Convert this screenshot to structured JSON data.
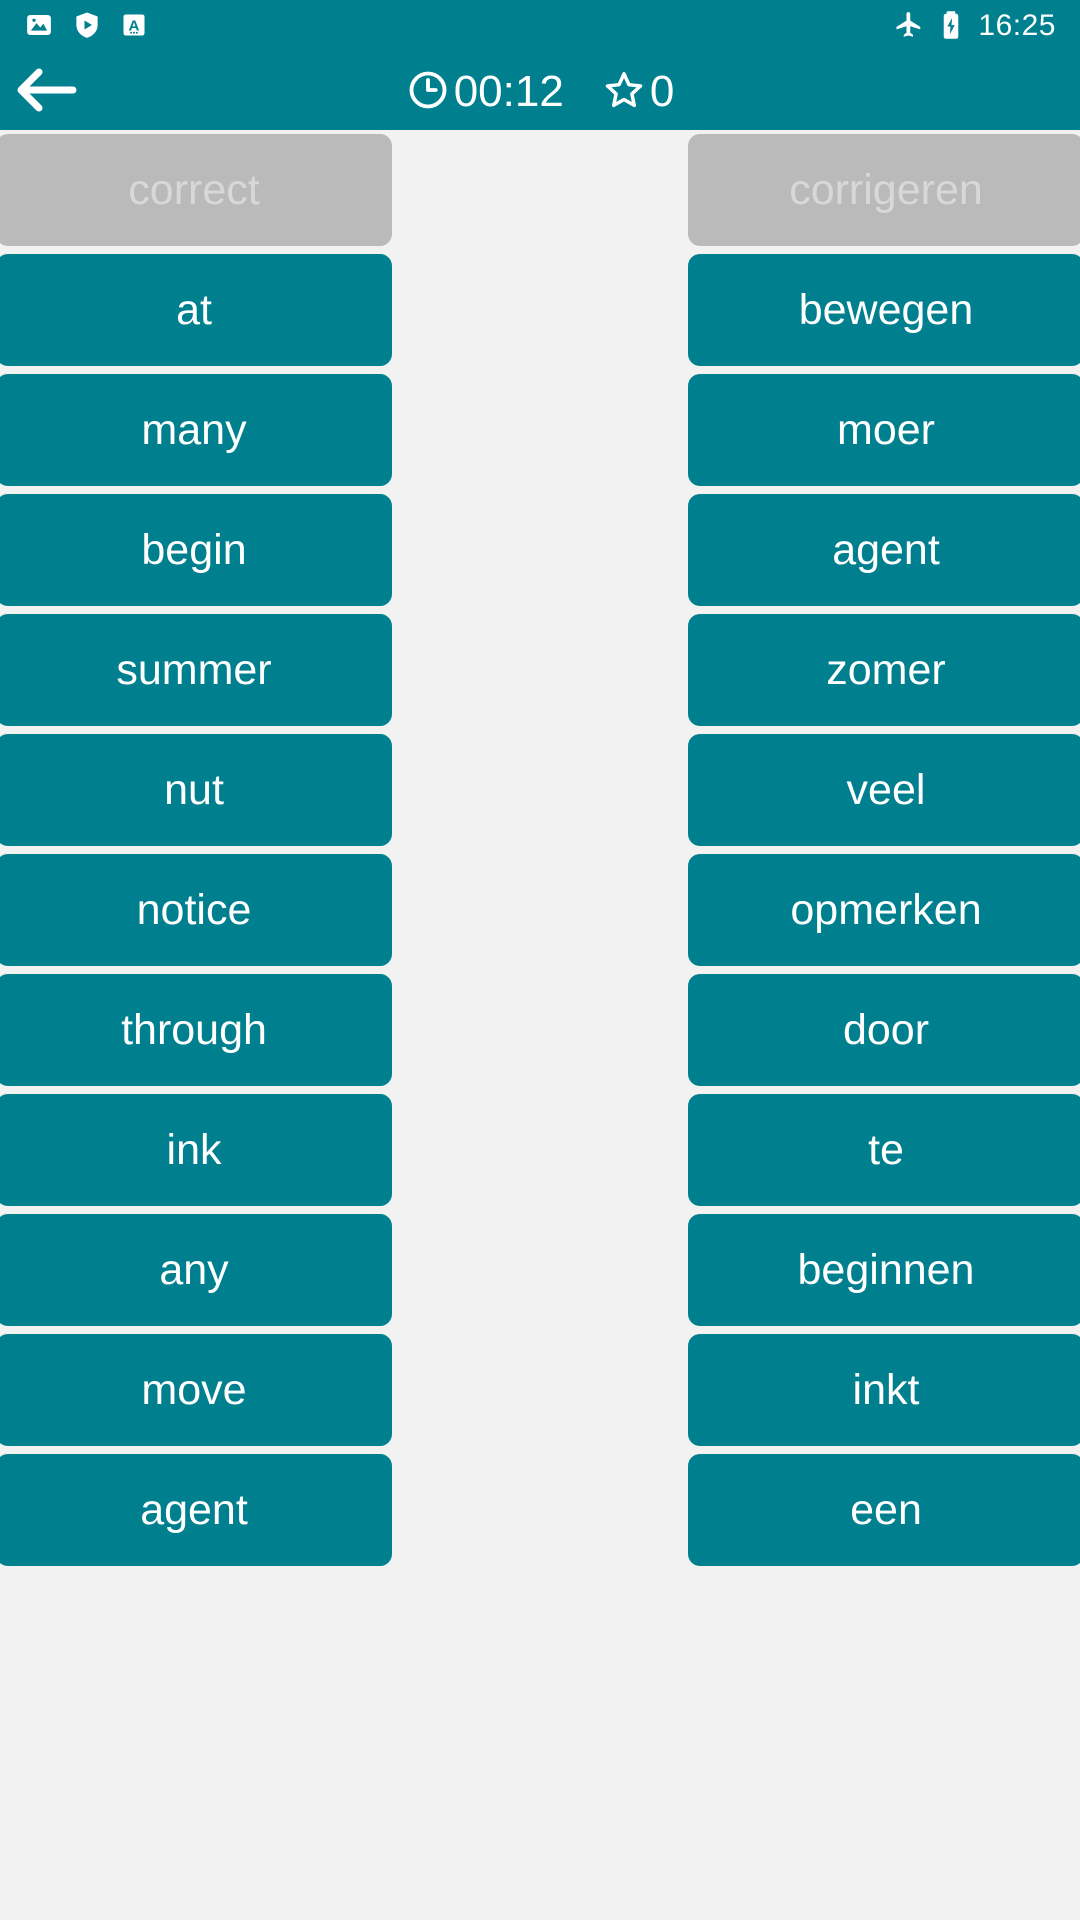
{
  "status_bar": {
    "icons": [
      "photo-icon",
      "shield-play-icon",
      "translate-a-icon"
    ],
    "right_icons": [
      "airplane-mode-icon",
      "battery-charging-icon"
    ],
    "clock": "16:25"
  },
  "app_bar": {
    "back_icon": "back-arrow-icon",
    "timer_icon": "clock-icon",
    "timer_value": "00:12",
    "score_icon": "star-outline-icon",
    "score_value": "0"
  },
  "theme": {
    "accent": "#00808f",
    "card_matched_bg": "#bababa",
    "card_matched_text": "#d8d8d8",
    "page_bg": "#f2f2f2",
    "card_text": "#ffffff"
  },
  "board": {
    "left_column": [
      {
        "label": "correct",
        "state": "matched"
      },
      {
        "label": "at",
        "state": "active"
      },
      {
        "label": "many",
        "state": "active"
      },
      {
        "label": "begin",
        "state": "active"
      },
      {
        "label": "summer",
        "state": "active"
      },
      {
        "label": "nut",
        "state": "active"
      },
      {
        "label": "notice",
        "state": "active"
      },
      {
        "label": "through",
        "state": "active"
      },
      {
        "label": "ink",
        "state": "active"
      },
      {
        "label": "any",
        "state": "active"
      },
      {
        "label": "move",
        "state": "active"
      },
      {
        "label": "agent",
        "state": "active"
      }
    ],
    "right_column": [
      {
        "label": "corrigeren",
        "state": "matched"
      },
      {
        "label": "bewegen",
        "state": "active"
      },
      {
        "label": "moer",
        "state": "active"
      },
      {
        "label": "agent",
        "state": "active"
      },
      {
        "label": "zomer",
        "state": "active"
      },
      {
        "label": "veel",
        "state": "active"
      },
      {
        "label": "opmerken",
        "state": "active"
      },
      {
        "label": "door",
        "state": "active"
      },
      {
        "label": "te",
        "state": "active"
      },
      {
        "label": "beginnen",
        "state": "active"
      },
      {
        "label": "inkt",
        "state": "active"
      },
      {
        "label": "een",
        "state": "active"
      }
    ]
  }
}
